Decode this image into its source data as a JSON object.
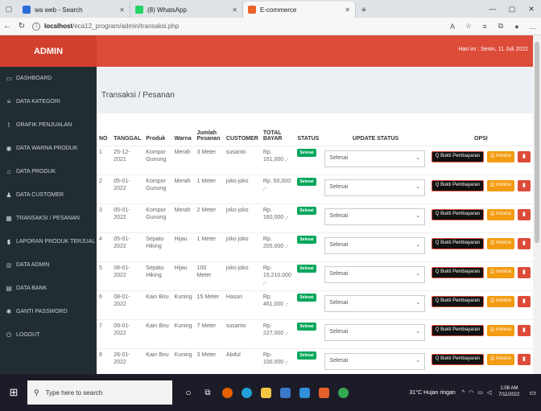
{
  "browser": {
    "tabs": [
      {
        "label": "wa web - Search",
        "icon": "search-icon",
        "color": "#2b6cd9"
      },
      {
        "label": "(8) WhatsApp",
        "icon": "whatsapp-icon",
        "color": "#25d366"
      },
      {
        "label": "E-commerce",
        "icon": "ecommerce-icon",
        "color": "#e8632b"
      }
    ],
    "url_host": "localhost",
    "url_path": "/eca12_program/admin/transaksi.php"
  },
  "header": {
    "brand": "ADMIN",
    "date_text": "Hari ini : Senin, 11 Juli 2022",
    "color": "#dd4b39"
  },
  "sidebar": {
    "items": [
      {
        "label": "DASHBOARD",
        "icon": "monitor-icon",
        "glyph": "▭"
      },
      {
        "label": "DATA KATEGORI",
        "icon": "list-icon",
        "glyph": "≡"
      },
      {
        "label": "GRAFIK PENJUALAN",
        "icon": "chart-icon",
        "glyph": "⌇"
      },
      {
        "label": "DATA WARNA PRODUK",
        "icon": "palette-icon",
        "glyph": "◉"
      },
      {
        "label": "DATA PRODUK",
        "icon": "bag-icon",
        "glyph": "⌂"
      },
      {
        "label": "DATA CUSTOMER",
        "icon": "users-icon",
        "glyph": "♟"
      },
      {
        "label": "TRANSAKSI / PESANAN",
        "icon": "table-icon",
        "glyph": "▦"
      },
      {
        "label": "LAPORAN PRODUK TERJUAL",
        "icon": "file-icon",
        "glyph": "▮"
      },
      {
        "label": "DATA ADMIN",
        "icon": "user-icon",
        "glyph": "◎"
      },
      {
        "label": "DATA BANK",
        "icon": "bank-icon",
        "glyph": "▤"
      },
      {
        "label": "GANTI PASSWORD",
        "icon": "key-icon",
        "glyph": "✱"
      },
      {
        "label": "LOGOUT",
        "icon": "power-icon",
        "glyph": "⏻"
      }
    ]
  },
  "main": {
    "title": "Transaksi / Pesanan",
    "columns": [
      "NO",
      "TANGGAL",
      "Produk",
      "Warna",
      "Jumlah Pesanan",
      "CUSTOMER",
      "TOTAL BAYAR",
      "STATUS",
      "UPDATE STATUS",
      "OPSI"
    ],
    "rows": [
      {
        "no": "1",
        "tanggal": "25-12-2021",
        "produk": "Kompor Gunung",
        "warna": "Merah",
        "jumlah": "3 Meter",
        "customer": "susanto",
        "total": "Rp. 161,000 ,-",
        "status": "Selesai",
        "update": "Selesai"
      },
      {
        "no": "2",
        "tanggal": "05-01-2022",
        "produk": "Kompor Gunung",
        "warna": "Merah",
        "jumlah": "1 Meter",
        "customer": "joko joko",
        "total": "Rp. 50,000 ,-",
        "status": "Selesai",
        "update": "Selesai"
      },
      {
        "no": "3",
        "tanggal": "05-01-2022",
        "produk": "Kompor Gunung",
        "warna": "Merah",
        "jumlah": "2 Meter",
        "customer": "joko joko",
        "total": "Rp. 160,000 ,-",
        "status": "Selesai",
        "update": "Selesai"
      },
      {
        "no": "4",
        "tanggal": "05-01-2022",
        "produk": "Sepatu Hiking",
        "warna": "Hijau",
        "jumlah": "1 Meter",
        "customer": "joko joko",
        "total": "Rp. 205,000 ,-",
        "status": "Selesai",
        "update": "Selesai"
      },
      {
        "no": "5",
        "tanggal": "08-01-2022",
        "produk": "Sepatu Hiking",
        "warna": "Hijau",
        "jumlah": "100 Meter",
        "customer": "joko joko",
        "total": "Rp. 15,210,000 ,-",
        "status": "Selesai",
        "update": "Selesai"
      },
      {
        "no": "6",
        "tanggal": "08-01-2022",
        "produk": "Kain Biru",
        "warna": "Kuning",
        "jumlah": "15 Meter",
        "customer": "Hasan",
        "total": "Rp. 461,000 ,-",
        "status": "Selesai",
        "update": "Selesai"
      },
      {
        "no": "7",
        "tanggal": "09-01-2022",
        "produk": "Kain Biru",
        "warna": "Kuning",
        "jumlah": "7 Meter",
        "customer": "susanto",
        "total": "Rp. 227,000 ,-",
        "status": "Selesai",
        "update": "Selesai"
      },
      {
        "no": "8",
        "tanggal": "26-01-2022",
        "produk": "Kain Biru",
        "warna": "Kuning",
        "jumlah": "3 Meter",
        "customer": "Abdul",
        "total": "Rp. 100,000 ,-",
        "status": "Selesai",
        "update": "Selesai"
      }
    ],
    "btn_bukti": "Q Bukti Pembayaran",
    "btn_invoice": "Invoice",
    "btn_delete_icon": "trash-icon"
  },
  "taskbar": {
    "search_placeholder": "Type here to search",
    "weather": "31°C  Hujan ringan",
    "time": "1:08 AM",
    "date": "7/11/2022"
  }
}
